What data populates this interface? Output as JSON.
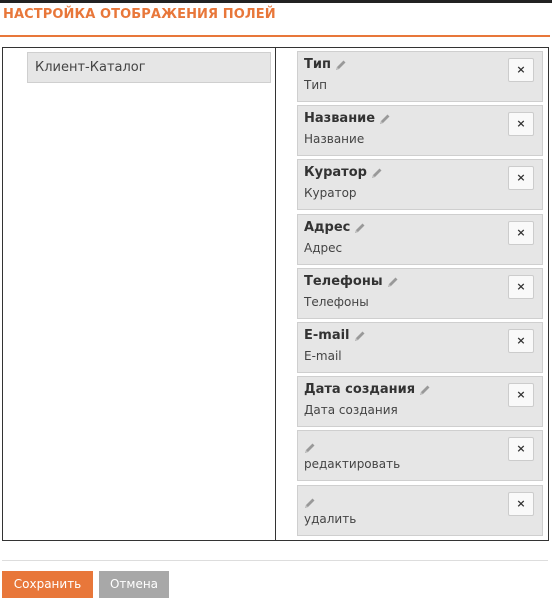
{
  "page": {
    "title": "НАСТРОЙКА ОТОБРАЖЕНИЯ ПОЛЕЙ"
  },
  "left": {
    "items": [
      {
        "label": "Клиент-Каталог"
      }
    ]
  },
  "fields": [
    {
      "title": "Тип",
      "subtitle": "Тип",
      "delete_icon": "×"
    },
    {
      "title": "Название",
      "subtitle": "Название",
      "delete_icon": "×"
    },
    {
      "title": "Куратор",
      "subtitle": "Куратор",
      "delete_icon": "×"
    },
    {
      "title": "Адрес",
      "subtitle": "Адрес",
      "delete_icon": "×"
    },
    {
      "title": "Телефоны",
      "subtitle": "Телефоны",
      "delete_icon": "×"
    },
    {
      "title": "E-mail",
      "subtitle": "E-mail",
      "delete_icon": "×"
    },
    {
      "title": "Дата создания",
      "subtitle": "Дата создания",
      "delete_icon": "×"
    },
    {
      "title": "",
      "subtitle": "редактировать",
      "delete_icon": "×"
    },
    {
      "title": "",
      "subtitle": "удалить",
      "delete_icon": "×"
    }
  ],
  "icons": {
    "edit": "pencil-icon",
    "delete": "close-icon"
  },
  "actions": {
    "save": "Сохранить",
    "cancel": "Отмена"
  },
  "colors": {
    "accent": "#e8773a",
    "cancel_bg": "#a8a8a8",
    "item_bg": "#e6e6e6"
  }
}
